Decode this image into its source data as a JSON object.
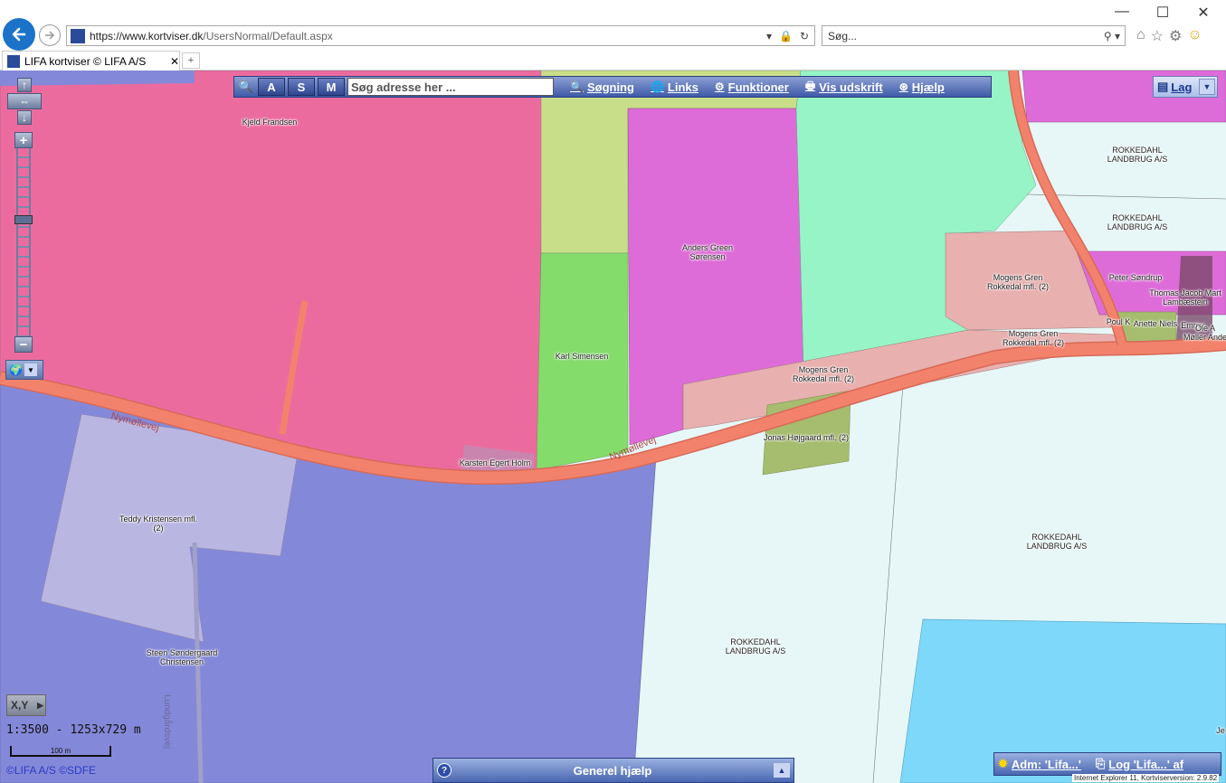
{
  "browser": {
    "url_main": "https://www.kortviser.dk",
    "url_path": "/UsersNormal/Default.aspx",
    "search_placeholder": "Søg...",
    "tab_title": "LIFA kortviser © LIFA A/S"
  },
  "toolbar": {
    "btn_a": "A",
    "btn_s": "S",
    "btn_m": "M",
    "search_placeholder": "Søg adresse her ...",
    "links": [
      "Søgning",
      "Links",
      "Funktioner",
      "Vis udskrift",
      "Hjælp"
    ]
  },
  "layers_button": "Lag",
  "map_labels": [
    {
      "text": "Kjeld Frandsen"
    },
    {
      "text": "ROKKEDAHL\nLANDBRUG A/S"
    },
    {
      "text": "ROKKEDAHL\nLANDBRUG A/S"
    },
    {
      "text": "Anders Green\nSørensen"
    },
    {
      "text": "Mogens Gren\nRokkedal mfl. (2)"
    },
    {
      "text": "Peter Søndrup"
    },
    {
      "text": "Thomas Jacob Mart\nLambæstein"
    },
    {
      "text": "Poul K"
    },
    {
      "text": "Anette Niels"
    },
    {
      "text": "Emmy"
    },
    {
      "text": "Ole A\nMøller Ande"
    },
    {
      "text": "Mogens Gren\nRokkedal mfl. (2)"
    },
    {
      "text": "Karl Simensen"
    },
    {
      "text": "Mogens Gren\nRokkedal mfl. (2)"
    },
    {
      "text": "Jonas Højgaard mfl. (2)"
    },
    {
      "text": "Karsten Egert Holm"
    },
    {
      "text": "Teddy Kristensen mfl.\n(2)"
    },
    {
      "text": "ROKKEDAHL\nLANDBRUG A/S"
    },
    {
      "text": "Steen Søndergaard\nChristensen"
    },
    {
      "text": "ROKKEDAHL\nLANDBRUG A/S"
    },
    {
      "text": "Je"
    }
  ],
  "road_labels": [
    "Nymøllevej",
    "Nymøllevej",
    "Lundgårdsvej"
  ],
  "xy_button": "X,Y",
  "scale_text": "1:3500 - 1253x729 m",
  "scalebar_label": "100 m",
  "copyright": "©LIFA A/S ©SDFE",
  "help_bar": "Generel hjælp",
  "adm_label": "Adm: 'Lifa...'",
  "log_label": "Log 'Lifa...' af",
  "version_text": "Internet Explorer 11, Kortviserversion: 2.9.82",
  "colors": {
    "parcel_pink": "#ec6b9f",
    "parcel_blue": "#8488d8",
    "parcel_green": "#84dc6a",
    "parcel_magenta": "#de6cd8",
    "parcel_mint": "#96f4c6",
    "parcel_lightcyan": "#e7f7f7",
    "parcel_sky": "#7dd8fa",
    "road": "#f3826c"
  }
}
